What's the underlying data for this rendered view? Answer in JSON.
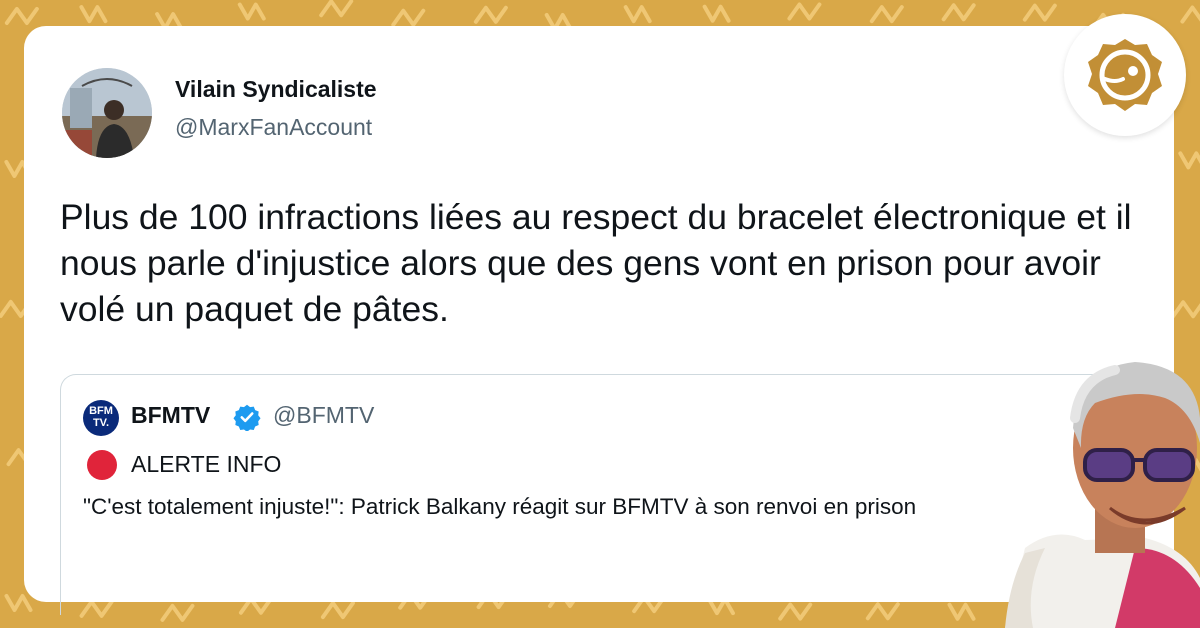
{
  "tweet": {
    "display_name": "Vilain Syndicaliste",
    "handle": "@MarxFanAccount",
    "text": "Plus de 100 infractions liées au respect du bracelet électronique et il nous parle d'injustice alors que des gens vont en prison pour avoir volé un paquet de pâtes."
  },
  "quoted_tweet": {
    "logo_text_line1": "BFM",
    "logo_text_line2": "TV.",
    "display_name": "BFMTV",
    "handle": "@BFMTV",
    "alert_label": "ALERTE INFO",
    "text": "\"C'est totalement injuste!\": Patrick Balkany réagit sur BFMTV à son renvoi en prison"
  },
  "colors": {
    "background": "#d9a848",
    "card": "#ffffff",
    "verified_blue": "#1d9bf0",
    "alert_red": "#e0243a",
    "bfm_blue": "#0a2a7a",
    "brand_gold": "#c28f36"
  },
  "icons": {
    "verified": "verified-badge-icon",
    "alert": "red-circle-icon",
    "brand": "brand-logo-icon"
  }
}
